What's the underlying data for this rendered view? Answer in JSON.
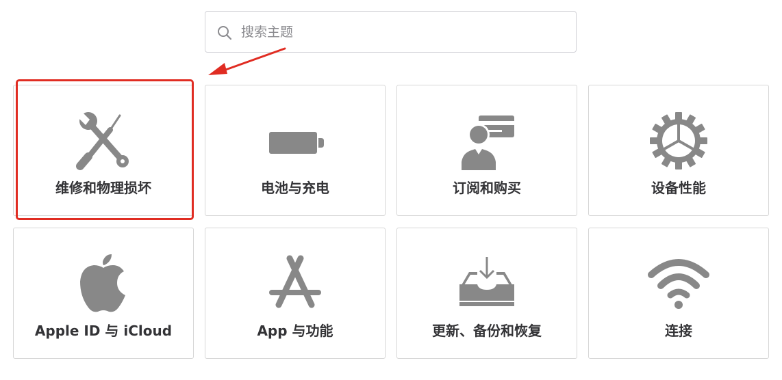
{
  "search": {
    "placeholder": "搜索主题",
    "icon": "search-icon"
  },
  "tiles": [
    {
      "label": "维修和物理损坏",
      "icon": "tools-icon"
    },
    {
      "label": "电池与充电",
      "icon": "battery-icon"
    },
    {
      "label": "订阅和购买",
      "icon": "subscription-user-card-icon"
    },
    {
      "label": "设备性能",
      "icon": "gear-icon"
    },
    {
      "label": "Apple ID 与 iCloud",
      "icon": "apple-icon"
    },
    {
      "label": "App 与功能",
      "icon": "app-store-icon"
    },
    {
      "label": "更新、备份和恢复",
      "icon": "download-tray-icon"
    },
    {
      "label": "连接",
      "icon": "wifi-icon"
    }
  ],
  "colors": {
    "icon": "#888888",
    "label": "#333336",
    "annotation": "#e02c22",
    "border": "#d6d6d6"
  }
}
